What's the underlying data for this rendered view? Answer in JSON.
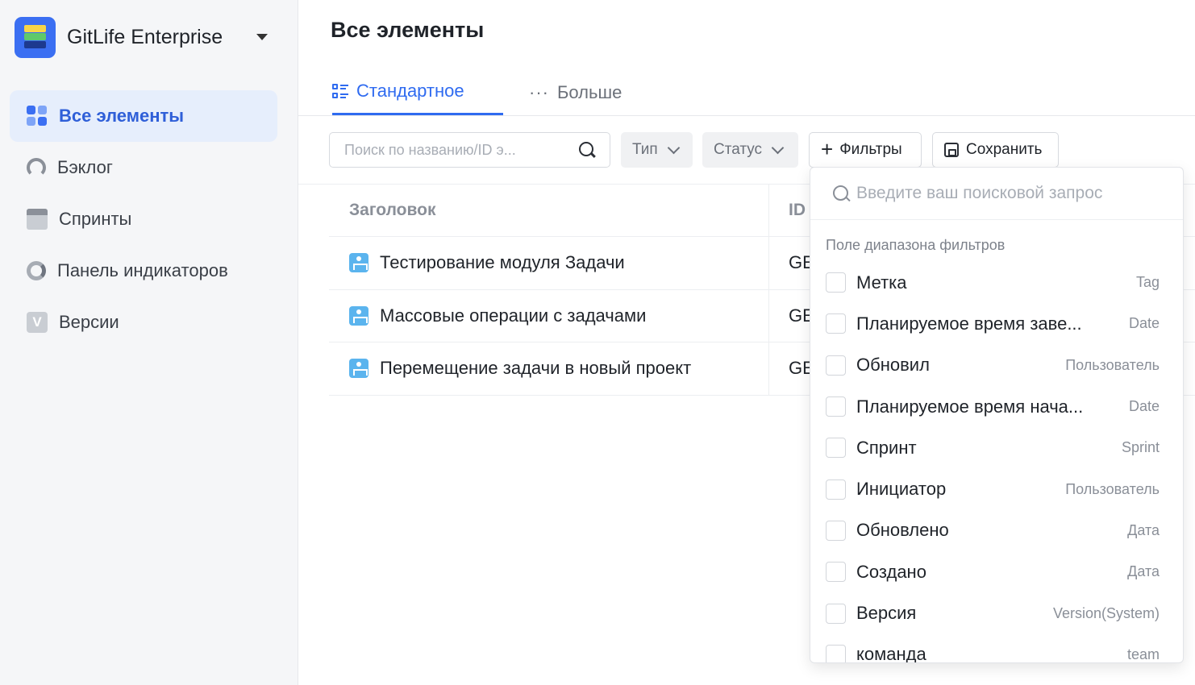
{
  "app": {
    "name": "GitLife Enterprise"
  },
  "sidebar": {
    "items": [
      {
        "label": "Все элементы",
        "icon": "grid-icon",
        "active": true
      },
      {
        "label": "Бэклог",
        "icon": "backlog-icon",
        "active": false
      },
      {
        "label": "Спринты",
        "icon": "sprint-icon",
        "active": false
      },
      {
        "label": "Панель индикаторов",
        "icon": "dashboard-icon",
        "active": false
      },
      {
        "label": "Версии",
        "icon": "version-icon",
        "active": false
      }
    ]
  },
  "main": {
    "title": "Все элементы",
    "tabs": [
      {
        "label": "Стандартное",
        "active": true
      },
      {
        "label": "Больше",
        "active": false
      }
    ],
    "toolbar": {
      "search_placeholder": "Поиск по названию/ID э...",
      "type_label": "Тип",
      "status_label": "Статус",
      "filters_label": "Фильтры",
      "save_label": "Сохранить"
    },
    "table": {
      "columns": [
        "Заголовок",
        "ID"
      ],
      "rows": [
        {
          "title": "Тестирование модуля Задачи",
          "id": "GE"
        },
        {
          "title": "Массовые операции с задачами",
          "id": "GE"
        },
        {
          "title": "Перемещение задачи в новый проект",
          "id": "GE"
        }
      ]
    }
  },
  "filter_dropdown": {
    "search_placeholder": "Введите ваш поисковой запрос",
    "section_title": "Поле диапазона фильтров",
    "items": [
      {
        "label": "Метка",
        "type": "Tag",
        "checked": false
      },
      {
        "label": "Планируемое время заве...",
        "type": "Date",
        "checked": false
      },
      {
        "label": "Обновил",
        "type": "Пользователь",
        "checked": false
      },
      {
        "label": "Планируемое время нача...",
        "type": "Date",
        "checked": false
      },
      {
        "label": "Спринт",
        "type": "Sprint",
        "checked": false
      },
      {
        "label": "Инициатор",
        "type": "Пользователь",
        "checked": false
      },
      {
        "label": "Обновлено",
        "type": "Дата",
        "checked": false
      },
      {
        "label": "Создано",
        "type": "Дата",
        "checked": false
      },
      {
        "label": "Версия",
        "type": "Version(System)",
        "checked": false
      },
      {
        "label": "команда",
        "type": "team",
        "checked": false
      }
    ]
  },
  "colors": {
    "accent": "#2f6bf0",
    "sidebar_bg": "#f5f6f8",
    "active_bg": "#e6eefc",
    "row_icon": "#5bb4ee"
  }
}
